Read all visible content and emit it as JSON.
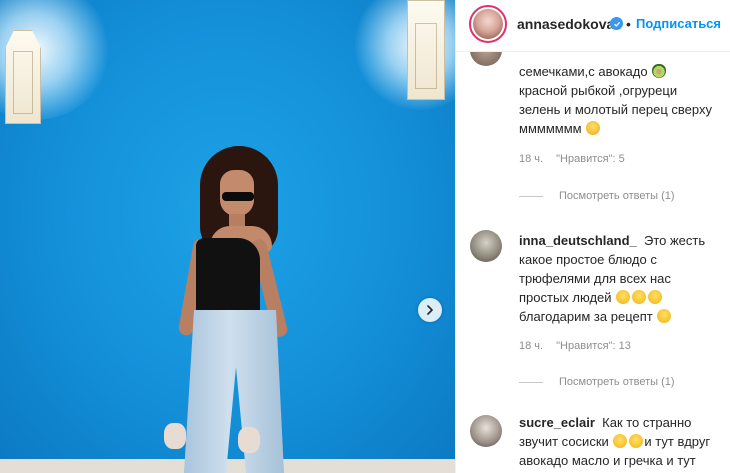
{
  "post": {
    "next_icon": "chevron-right-icon"
  },
  "header": {
    "username": "annasedokova",
    "separator": "•",
    "follow_label": "Подписаться",
    "verified_icon": "verified-badge-icon"
  },
  "comments": [
    {
      "lines": [
        "семечками,с авокадо",
        "красной рыбкой ,огруреци",
        "зелень и молотый перец сверху",
        "ммммммм"
      ],
      "time": "18 ч.",
      "likes": "\"Нравится\": 5",
      "replies": "Посмотреть ответы (1)"
    },
    {
      "username": "inna_deutschland_",
      "lines": [
        "Это жесть",
        "какое простое блюдо с",
        "трюфелями для всех нас",
        "простых людей",
        "благодарим за рецепт"
      ],
      "time": "18 ч.",
      "likes": "\"Нравится\": 13",
      "replies": "Посмотреть ответы (1)"
    },
    {
      "username": "sucre_eclair",
      "lines": [
        "Как то странно",
        "звучит сосиски",
        "и тут вдруг",
        "авокадо масло и гречка и тут"
      ]
    }
  ],
  "colors": {
    "wall_blue": "#138fd8",
    "link_blue": "#0095f6",
    "muted": "#8e8e8e"
  }
}
